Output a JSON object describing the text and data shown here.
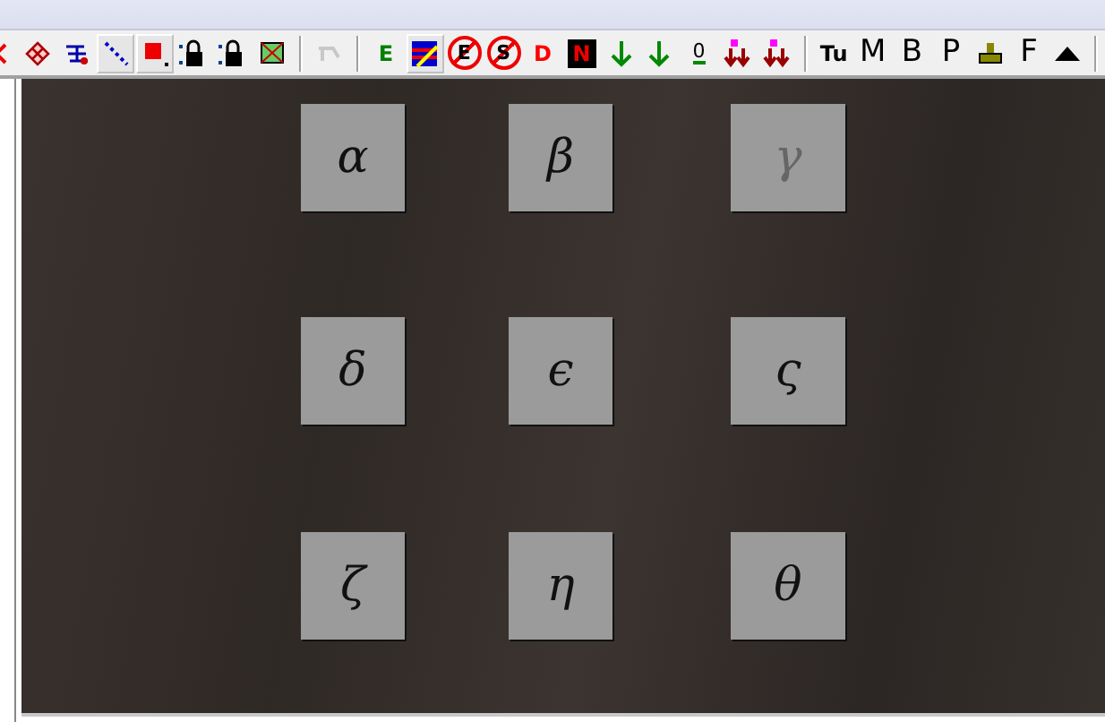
{
  "toolbar": {
    "groups": [
      [
        {
          "kind": "icon",
          "pressed": false,
          "disabled": false
        },
        {
          "kind": "icon",
          "pressed": false,
          "disabled": false
        },
        {
          "kind": "icon",
          "pressed": false,
          "disabled": false
        },
        {
          "kind": "icon",
          "pressed": true,
          "disabled": false
        },
        {
          "kind": "icon",
          "pressed": true,
          "disabled": false
        },
        {
          "kind": "icon",
          "pressed": false,
          "disabled": false
        },
        {
          "kind": "icon",
          "pressed": false,
          "disabled": false
        },
        {
          "kind": "icon",
          "pressed": false,
          "disabled": false
        }
      ],
      [
        {
          "kind": "icon",
          "pressed": false,
          "disabled": true
        }
      ],
      [
        {
          "kind": "glyph",
          "label": "E",
          "color": "#008000",
          "pressed": false,
          "disabled": false
        },
        {
          "kind": "icon",
          "pressed": true,
          "disabled": false
        },
        {
          "kind": "no-sign",
          "label": "E",
          "pressed": false,
          "disabled": false
        },
        {
          "kind": "no-sign",
          "label": "S",
          "pressed": false,
          "disabled": false
        },
        {
          "kind": "glyph",
          "label": "D",
          "color": "#ff0000",
          "pressed": false,
          "disabled": false
        },
        {
          "kind": "no-box",
          "label": "N",
          "pressed": false,
          "disabled": false
        },
        {
          "kind": "icon",
          "pressed": false,
          "disabled": false
        },
        {
          "kind": "icon",
          "pressed": false,
          "disabled": false
        },
        {
          "kind": "underlined",
          "label": "0",
          "pressed": false,
          "disabled": false
        },
        {
          "kind": "icon",
          "pressed": false,
          "disabled": false
        },
        {
          "kind": "icon",
          "pressed": false,
          "disabled": false
        }
      ],
      [
        {
          "kind": "glyph",
          "label": "Tu",
          "color": "#000000",
          "pressed": false,
          "disabled": false
        },
        {
          "kind": "glyph",
          "label": "M",
          "color": "#000000",
          "pressed": false,
          "disabled": false
        },
        {
          "kind": "glyph",
          "label": "B",
          "color": "#000000",
          "pressed": false,
          "disabled": false
        },
        {
          "kind": "glyph",
          "label": "P",
          "color": "#000000",
          "pressed": false,
          "disabled": false
        },
        {
          "kind": "icon",
          "pressed": false,
          "disabled": false
        },
        {
          "kind": "glyph",
          "label": "F",
          "color": "#000000",
          "pressed": false,
          "disabled": false
        },
        {
          "kind": "icon",
          "pressed": false,
          "disabled": false
        }
      ]
    ]
  },
  "tiles": [
    {
      "letter": "α",
      "faded": false
    },
    {
      "letter": "β",
      "faded": false
    },
    {
      "letter": "γ",
      "faded": true
    },
    {
      "letter": "δ",
      "faded": false
    },
    {
      "letter": "ϵ",
      "faded": false
    },
    {
      "letter": "ς",
      "faded": false
    },
    {
      "letter": "ζ",
      "faded": false
    },
    {
      "letter": "η",
      "faded": false
    },
    {
      "letter": "θ",
      "faded": false
    }
  ]
}
